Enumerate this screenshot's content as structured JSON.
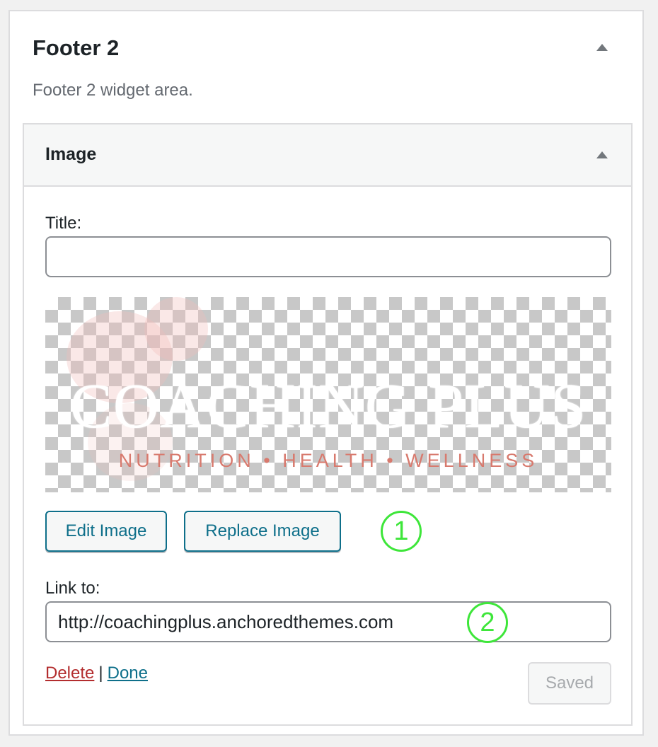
{
  "sidebar": {
    "title": "Footer 2",
    "description": "Footer 2 widget area."
  },
  "widget": {
    "title": "Image",
    "title_label": "Title:",
    "title_value": "",
    "image": {
      "logo_text": "COACHING PLUS",
      "tagline": "NUTRITION • HEALTH • WELLNESS"
    },
    "edit_image_label": "Edit Image",
    "replace_image_label": "Replace Image",
    "link_label": "Link to:",
    "link_value": "http://coachingplus.anchoredthemes.com",
    "delete_label": "Delete",
    "separator": "|",
    "done_label": "Done",
    "saved_label": "Saved"
  },
  "annotations": [
    "1",
    "2"
  ],
  "colors": {
    "annotation": "#3ee63a",
    "link": "#0e6f8a",
    "delete": "#b32d2e",
    "tagline": "#d87a6e"
  },
  "icons": {
    "collapse": "triangle-up-icon"
  }
}
